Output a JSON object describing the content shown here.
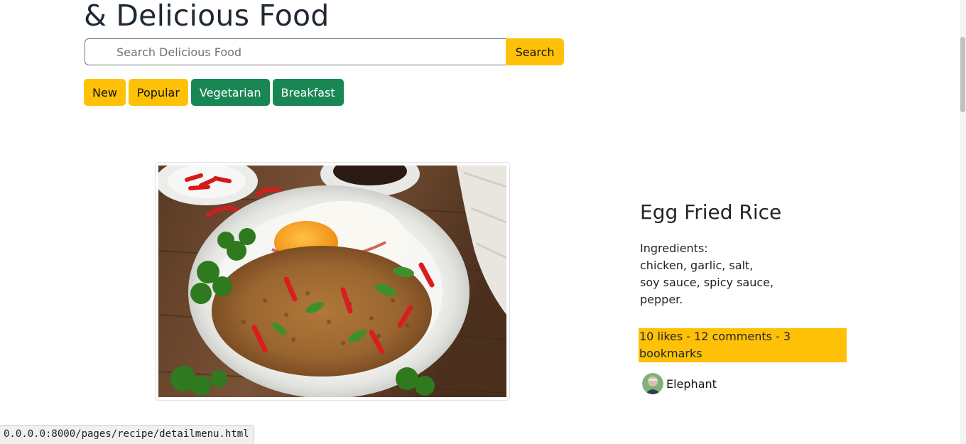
{
  "hero": {
    "title": "& Delicious Food"
  },
  "search": {
    "placeholder": "Search Delicious Food",
    "value": "",
    "button_label": "Search"
  },
  "tags": [
    {
      "label": "New",
      "color": "#ffc107"
    },
    {
      "label": "Popular",
      "color": "#ffc107"
    },
    {
      "label": "Vegetarian",
      "color": "#198754"
    },
    {
      "label": "Breakfast",
      "color": "#198754"
    }
  ],
  "recipe": {
    "image_icon": "egg-fried-rice-photo",
    "title": "Egg Fried Rice",
    "ingredients_heading": "Ingredients:",
    "ingredients_lines": [
      "chicken, garlic, salt,",
      "soy sauce, spicy sauce,",
      "pepper."
    ],
    "stats": "10 likes - 12 comments - 3 bookmarks",
    "author": {
      "name": "Elephant",
      "avatar_icon": "user-avatar"
    }
  },
  "status_bar": {
    "url": "0.0.0.0:8000/pages/recipe/detailmenu.html"
  },
  "colors": {
    "accent_yellow": "#ffc107",
    "accent_green": "#198754"
  }
}
